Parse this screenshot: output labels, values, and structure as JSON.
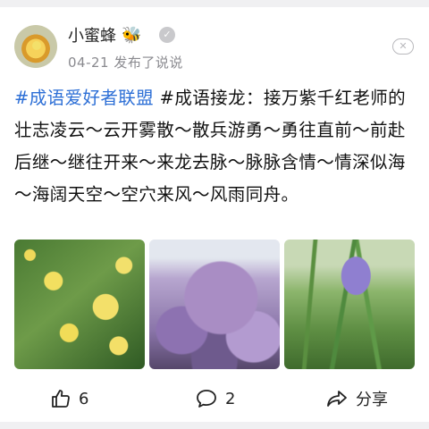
{
  "post": {
    "author": "小蜜蜂",
    "author_emoji": "🐝",
    "meta": "04-21 发布了说说",
    "hashtag": "#成语爱好者联盟",
    "text": " #成语接龙：接万紫千红老师的壮志凌云～云开雾散～散兵游勇～勇往直前～前赴后继～继往开来～来龙去脉～脉脉含情～情深似海～海阔天空～空穴来风～风雨同舟。"
  },
  "photos": [
    {
      "name": "yellow-rose-photo"
    },
    {
      "name": "wisteria-photo"
    },
    {
      "name": "iris-photo"
    }
  ],
  "actions": {
    "like_count": "6",
    "comment_count": "2",
    "share_label": "分享"
  },
  "icons": {
    "verify": "verified-badge-icon",
    "close": "close-icon",
    "like": "thumbs-up-icon",
    "comment": "comment-bubble-icon",
    "share": "share-arrow-icon"
  }
}
